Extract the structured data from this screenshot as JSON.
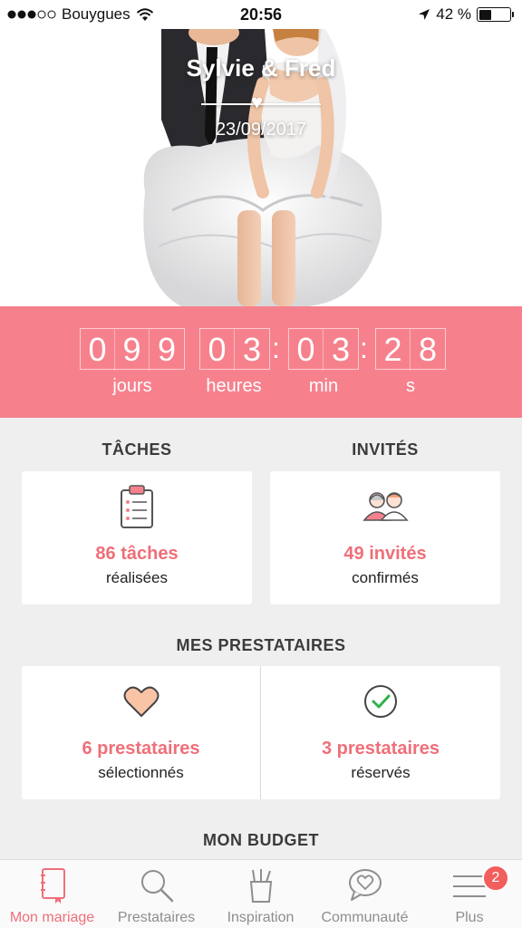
{
  "status_bar": {
    "carrier": "Bouygues",
    "time": "20:56",
    "battery": "42 %",
    "battery_level": 0.42
  },
  "hero": {
    "couple_names": "Sylvie & Fred",
    "wedding_date": "23/09/2017"
  },
  "countdown": {
    "days_digits": [
      "0",
      "9",
      "9"
    ],
    "hours_digits": [
      "0",
      "3"
    ],
    "minutes_digits": [
      "0",
      "3"
    ],
    "seconds_digits": [
      "2",
      "8"
    ],
    "labels": {
      "days": "jours",
      "hours": "heures",
      "minutes": "min",
      "seconds": "s"
    }
  },
  "tasks": {
    "title": "TÂCHES",
    "count": "86 tâches",
    "status": "réalisées"
  },
  "guests": {
    "title": "INVITÉS",
    "count": "49 invités",
    "status": "confirmés"
  },
  "vendors": {
    "title": "MES PRESTATAIRES",
    "selected_count": "6 prestataires",
    "selected_status": "sélectionnés",
    "booked_count": "3 prestataires",
    "booked_status": "réservés"
  },
  "budget": {
    "title": "MON BUDGET"
  },
  "bottom_nav": {
    "items": [
      {
        "label": "Mon mariage",
        "icon": "notebook-icon",
        "active": true
      },
      {
        "label": "Prestataires",
        "icon": "search-icon",
        "active": false
      },
      {
        "label": "Inspiration",
        "icon": "pencil-cup-icon",
        "active": false
      },
      {
        "label": "Communauté",
        "icon": "chat-heart-icon",
        "active": false
      },
      {
        "label": "Plus",
        "icon": "menu-icon",
        "active": false
      }
    ],
    "badge": "2"
  },
  "colors": {
    "accent": "#f6818d",
    "accent_text": "#ef6f79",
    "badge": "#f25d5d"
  }
}
